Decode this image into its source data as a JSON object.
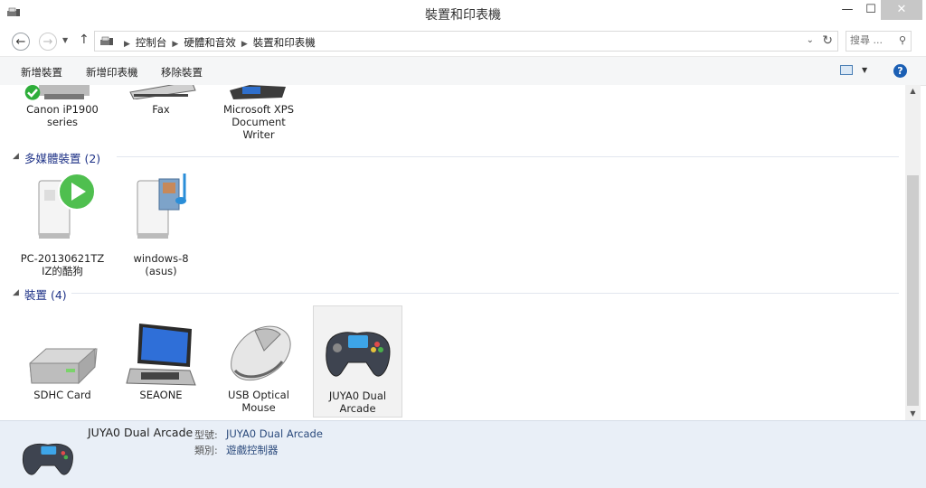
{
  "window": {
    "title": "裝置和印表機"
  },
  "breadcrumb": {
    "items": [
      "控制台",
      "硬體和音效",
      "裝置和印表機"
    ]
  },
  "search": {
    "placeholder": "搜尋 ..."
  },
  "toolbar": {
    "add_device": "新增裝置",
    "add_printer": "新增印表機",
    "remove_device": "移除裝置"
  },
  "printers": {
    "items": [
      {
        "line1": "Canon iP1900",
        "line2": "series",
        "line3": ""
      },
      {
        "line1": "Fax",
        "line2": "",
        "line3": ""
      },
      {
        "line1": "Microsoft XPS",
        "line2": "Document",
        "line3": "Writer"
      }
    ]
  },
  "multimedia": {
    "title": "多媒體裝置 (2)",
    "items": [
      {
        "line1": "PC-20130621TZ",
        "line2": "IZ的酷狗"
      },
      {
        "line1": "windows-8",
        "line2": "(asus)"
      }
    ]
  },
  "devices": {
    "title": "裝置 (4)",
    "items": [
      {
        "line1": "SDHC Card",
        "line2": ""
      },
      {
        "line1": "SEAONE",
        "line2": ""
      },
      {
        "line1": "USB Optical",
        "line2": "Mouse"
      },
      {
        "line1": "JUYA0 Dual",
        "line2": "Arcade"
      }
    ]
  },
  "details": {
    "name": "JUYA0 Dual Arcade",
    "model_label": "型號:",
    "model_value": "JUYA0 Dual Arcade",
    "category_label": "類別:",
    "category_value": "遊戲控制器"
  },
  "icons": {
    "back": "back-arrow-icon",
    "forward": "forward-arrow-icon",
    "up": "up-arrow-icon",
    "refresh": "refresh-icon",
    "search": "search-icon",
    "help": "help-icon",
    "view": "change-view-icon",
    "check": "check-mark-icon"
  },
  "colors": {
    "group_title": "#1e3287",
    "details_bg": "#e9eff7",
    "close_button": "#c7c7c7",
    "help": "#1b5fb4"
  }
}
